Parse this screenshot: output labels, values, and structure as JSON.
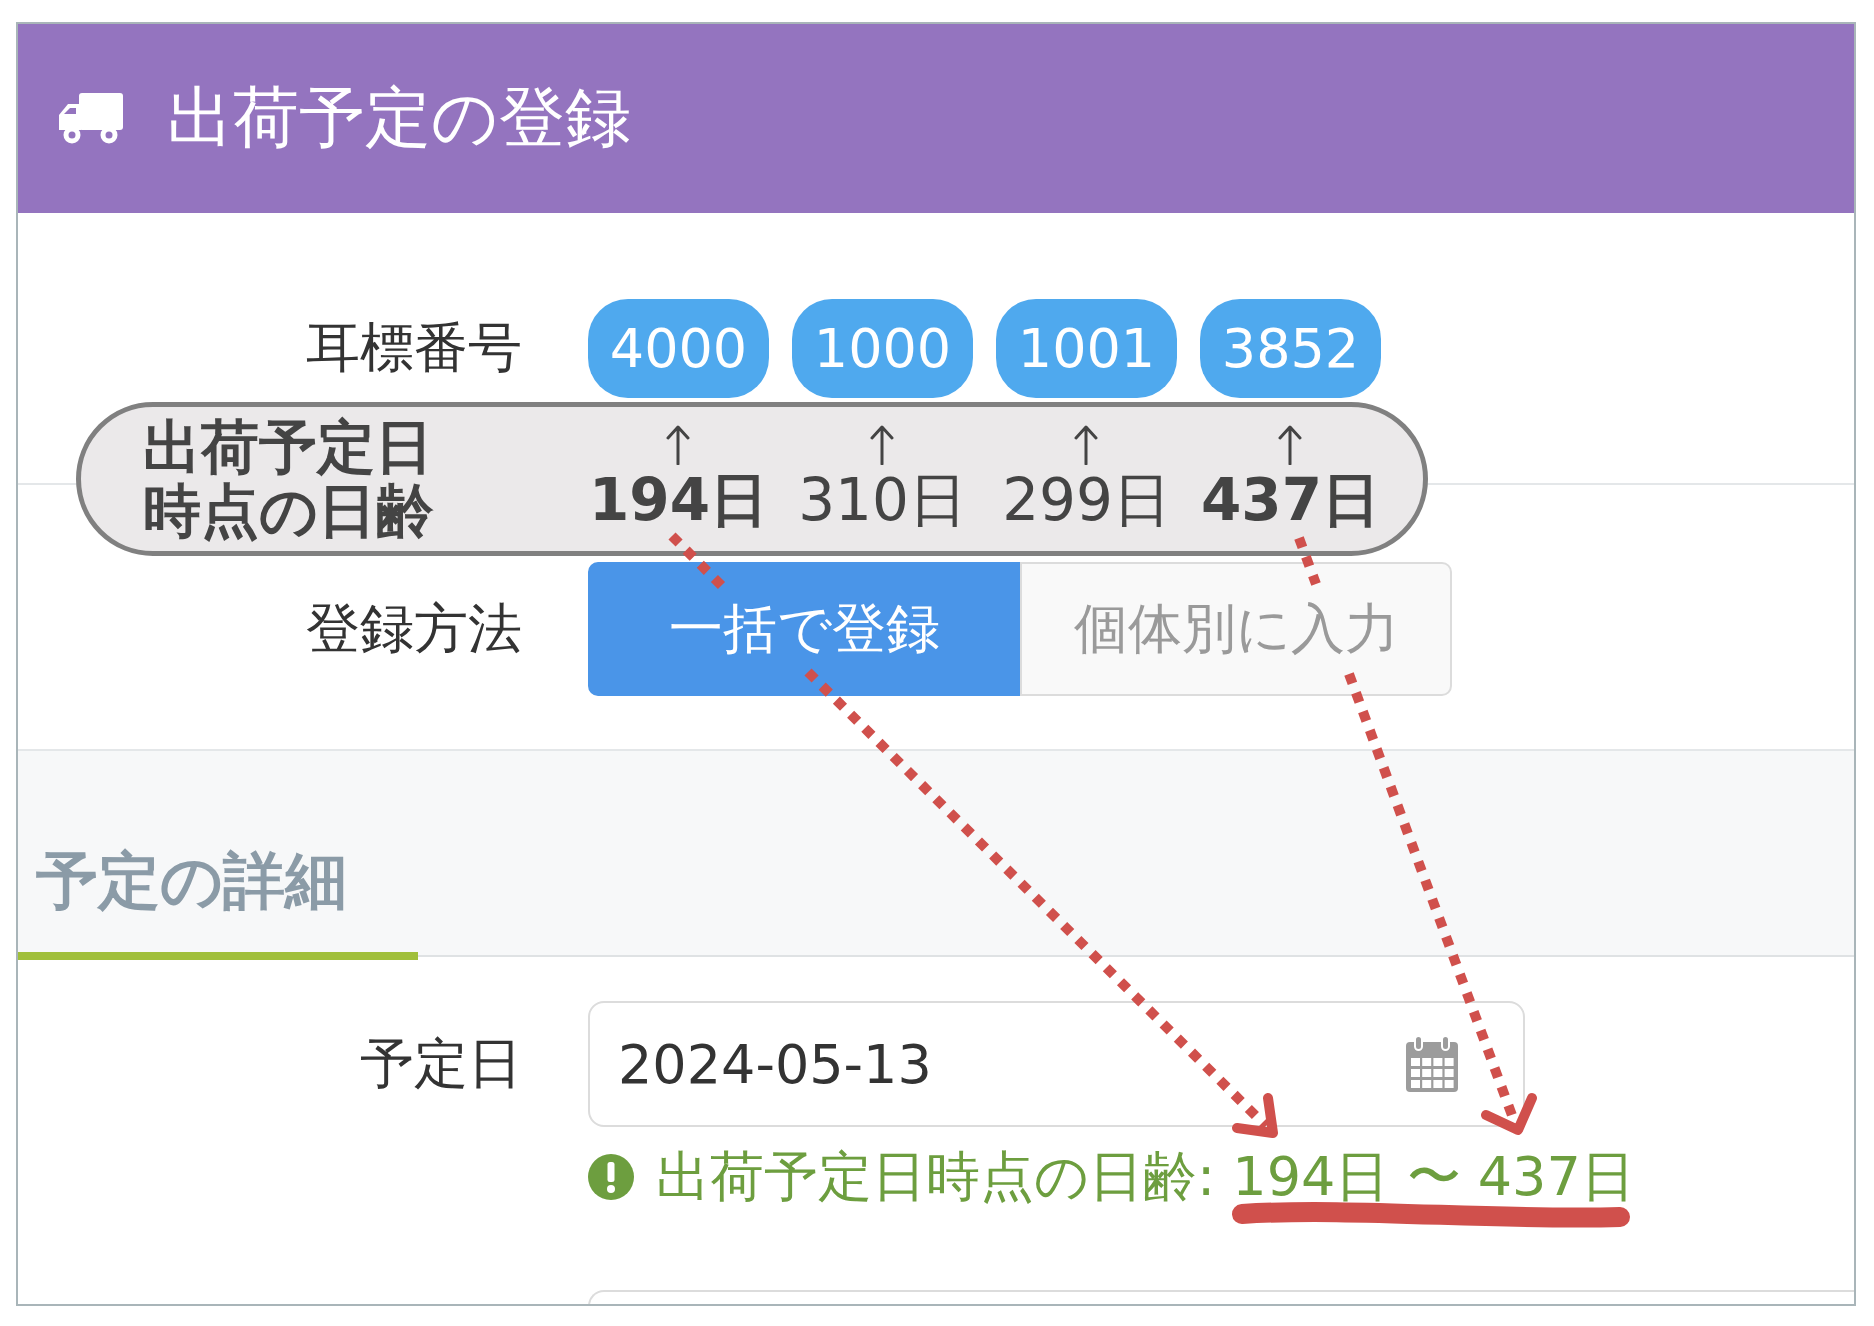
{
  "header": {
    "title": "出荷予定の登録"
  },
  "ear_tags": {
    "label": "耳標番号",
    "tags": [
      "4000",
      "1000",
      "1001",
      "3852"
    ]
  },
  "registration_method": {
    "label": "登録方法",
    "options": [
      {
        "label": "一括で登録",
        "selected": true
      },
      {
        "label": "個体別に入力",
        "selected": false
      }
    ]
  },
  "details": {
    "title": "予定の詳細",
    "scheduled_date": {
      "label": "予定日",
      "value": "2024-05-13",
      "help_text": "出荷予定日時点の日齢: 194日 〜 437日"
    }
  },
  "annotation": {
    "label": "出荷予定日時点の日齢",
    "ages": [
      {
        "value": "194日",
        "emphasized": true
      },
      {
        "value": "310日",
        "emphasized": false
      },
      {
        "value": "299日",
        "emphasized": false
      },
      {
        "value": "437日",
        "emphasized": true
      }
    ]
  }
}
